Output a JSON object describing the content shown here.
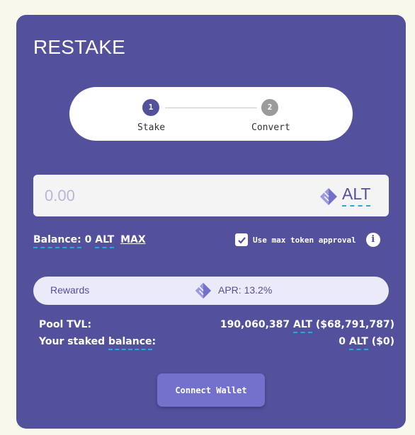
{
  "card": {
    "title": "RESTAKE"
  },
  "stepper": {
    "steps": [
      {
        "number": "1",
        "label": "Stake",
        "active": true
      },
      {
        "number": "2",
        "label": "Convert",
        "active": false
      }
    ]
  },
  "amount": {
    "placeholder": "0.00",
    "value": "",
    "token": "ALT",
    "token_icon": "alt-token-icon"
  },
  "balance": {
    "label": "Balance:",
    "amount": "0",
    "token": "ALT",
    "max_label": "MAX"
  },
  "approval": {
    "label": "Use max token approval",
    "checked": true,
    "info_icon": "i"
  },
  "rewards": {
    "label": "Rewards",
    "apr_text": "APR: 13.2%"
  },
  "stats": {
    "pool_tvl_label": "Pool TVL:",
    "pool_tvl_amount": "190,060,387",
    "pool_tvl_token": "ALT",
    "pool_tvl_usd": "($68,791,787)",
    "staked_label_prefix": "Your staked",
    "staked_label_word": "balance",
    "staked_label_suffix": ":",
    "staked_amount": "0",
    "staked_token": "ALT",
    "staked_usd": "($0)"
  },
  "actions": {
    "connect_wallet": "Connect Wallet"
  },
  "colors": {
    "background": "#f8f8ec",
    "card": "#53509c",
    "accent": "#7471cc",
    "dashed_underline": "#29a8e0"
  }
}
